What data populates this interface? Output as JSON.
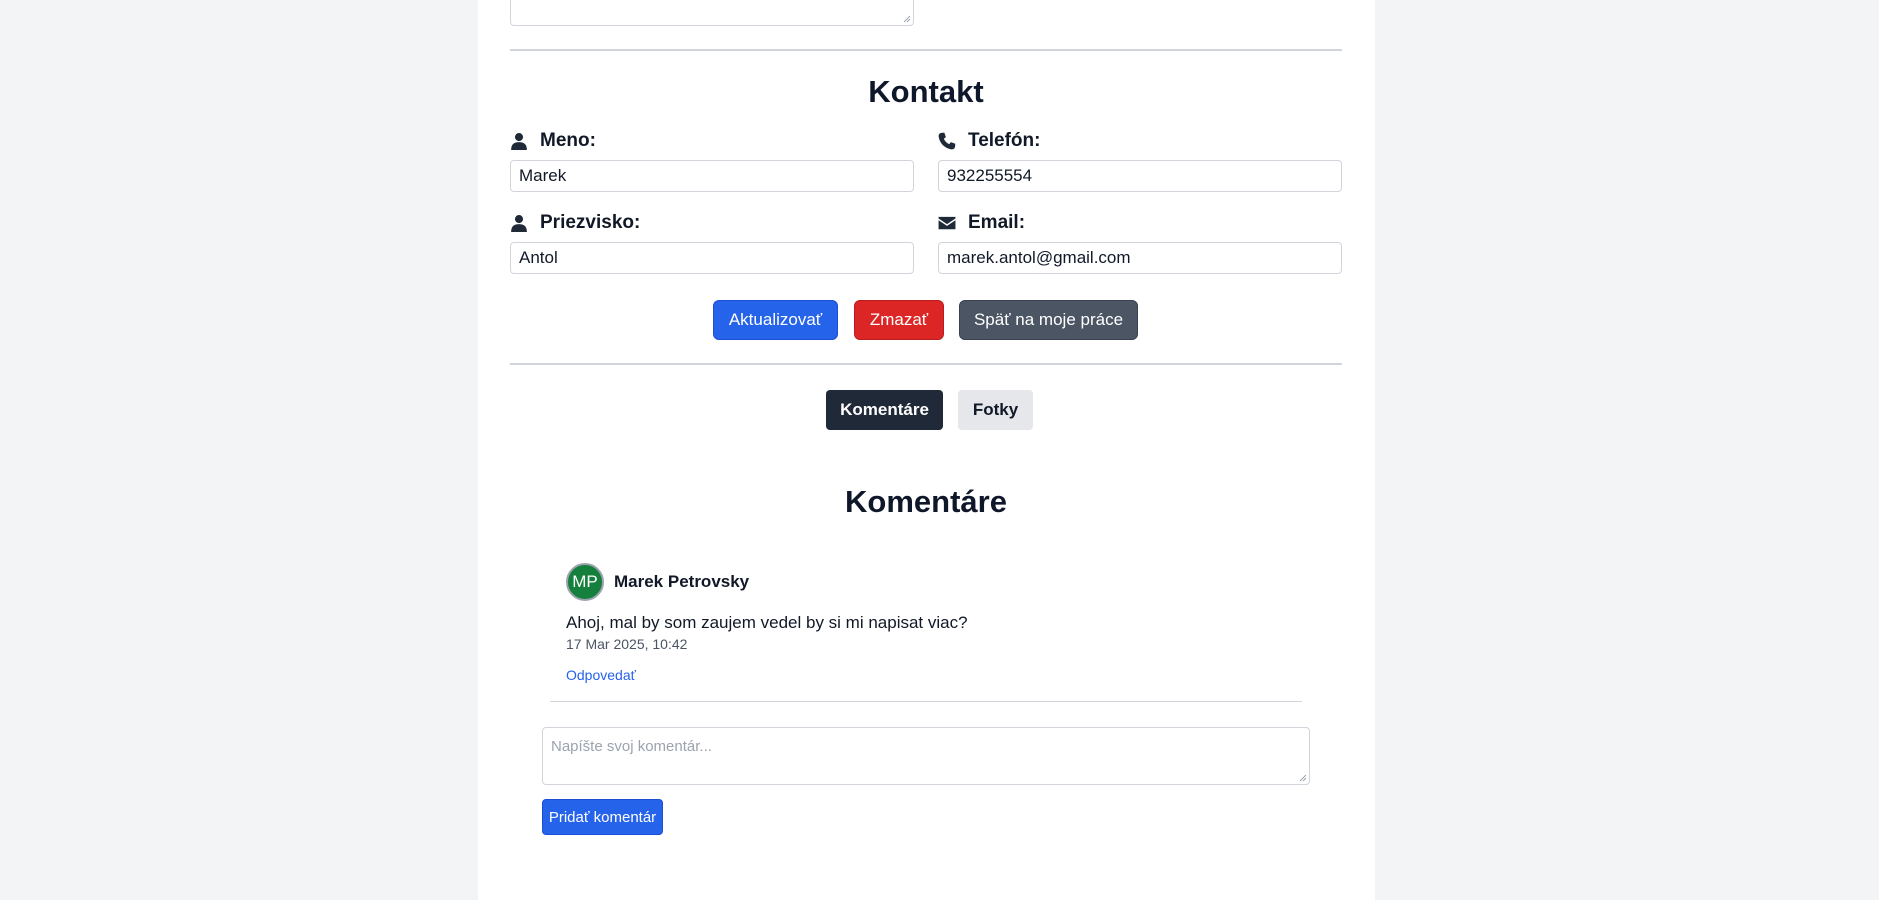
{
  "contact": {
    "heading": "Kontakt",
    "first_name": {
      "label": "Meno:",
      "value": "Marek",
      "icon": "user-icon"
    },
    "phone": {
      "label": "Telefón:",
      "value": "932255554",
      "icon": "phone-icon"
    },
    "last_name": {
      "label": "Priezvisko:",
      "value": "Antol",
      "icon": "user-icon"
    },
    "email": {
      "label": "Email:",
      "value": "marek.antol@gmail.com",
      "icon": "envelope-icon"
    }
  },
  "actions": {
    "update_label": "Aktualizovať",
    "delete_label": "Zmazať",
    "back_label": "Späť na moje práce"
  },
  "tabs": [
    {
      "label": "Komentáre",
      "active": true
    },
    {
      "label": "Fotky",
      "active": false
    }
  ],
  "comments": {
    "heading": "Komentáre",
    "items": [
      {
        "initials": "MP",
        "author": "Marek Petrovsky",
        "text": "Ahoj, mal by som zaujem vedel by si mi napisat viac?",
        "date": "17 Mar 2025, 10:42",
        "reply_label": "Odpovedať"
      }
    ],
    "input_placeholder": "Napíšte svoj komentár...",
    "submit_label": "Pridať komentár"
  },
  "colors": {
    "primary": "#2563eb",
    "danger": "#dc2626",
    "secondary": "#4b5563",
    "tab_active": "#1f2937",
    "avatar": "#15803d"
  }
}
